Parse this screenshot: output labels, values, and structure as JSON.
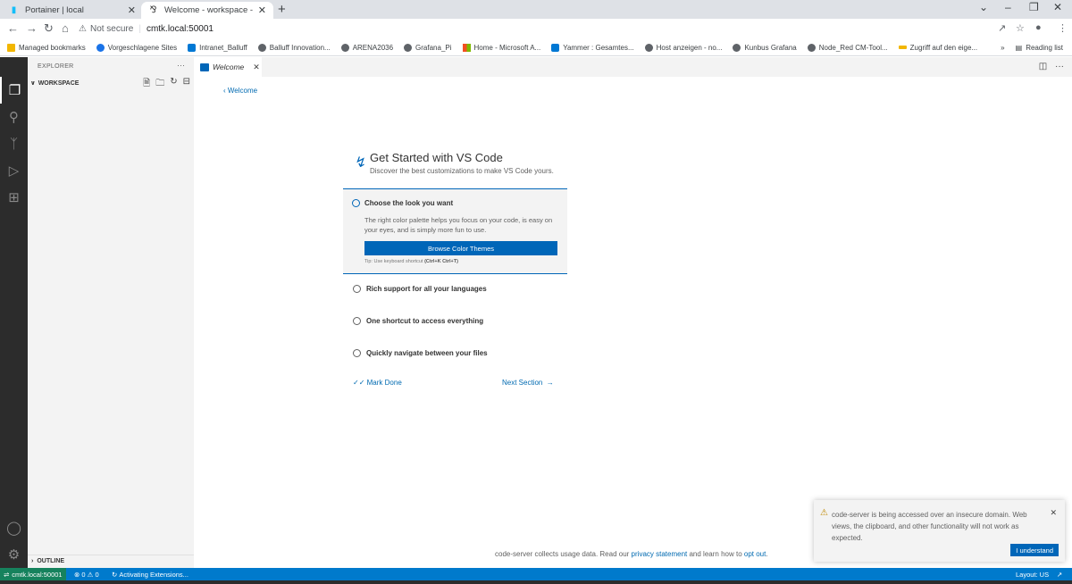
{
  "browser": {
    "tabs": [
      {
        "title": "Portainer | local",
        "icon": "portainer-icon"
      },
      {
        "title": "Welcome - workspace - code-se",
        "icon": "vscode-icon"
      }
    ],
    "address": {
      "security": "Not secure",
      "url": "cmtk.local:50001"
    },
    "bookmarks": [
      {
        "label": "Managed bookmarks",
        "icon": "folder"
      },
      {
        "label": "Vorgeschlagene Sites",
        "icon": "bing"
      },
      {
        "label": "Intranet_Balluff",
        "icon": "sharepoint"
      },
      {
        "label": "Balluff Innovation...",
        "icon": "globe"
      },
      {
        "label": "ARENA2036",
        "icon": "globe"
      },
      {
        "label": "Grafana_Pi",
        "icon": "globe"
      },
      {
        "label": "Home - Microsoft A...",
        "icon": "microsoft"
      },
      {
        "label": "Yammer : Gesamtes...",
        "icon": "yammer"
      },
      {
        "label": "Host anzeigen - no...",
        "icon": "globe"
      },
      {
        "label": "Kunbus Grafana",
        "icon": "globe"
      },
      {
        "label": "Node_Red CM-Tool...",
        "icon": "globe"
      },
      {
        "label": "Zugriff auf den eige...",
        "icon": "link"
      }
    ],
    "bookmarks_more": "»",
    "reading_list": "Reading list"
  },
  "vscode": {
    "sidebar": {
      "header": "EXPLORER",
      "workspace": "WORKSPACE",
      "outline": "OUTLINE"
    },
    "editor_tab": "Welcome",
    "back_link": "Welcome",
    "walkthrough": {
      "title": "Get Started with VS Code",
      "subtitle": "Discover the best customizations to make VS Code yours.",
      "expanded_step": {
        "title": "Choose the look you want",
        "description": "The right color palette helps you focus on your code, is easy on your eyes, and is simply more fun to use.",
        "button": "Browse Color Themes",
        "tip_prefix": "Tip: Use keyboard shortcut",
        "tip_shortcut": "(Ctrl+K Ctrl+T)"
      },
      "steps": [
        "Rich support for all your languages",
        "One shortcut to access everything",
        "Quickly navigate between your files"
      ],
      "mark_done": "Mark Done",
      "next_section": "Next Section"
    },
    "footer": {
      "prefix": "code-server collects usage data. Read our",
      "privacy_link": "privacy statement",
      "middle": "and learn how to",
      "opt_out_link": "opt out",
      "suffix": "."
    },
    "notification": {
      "message": "code-server is being accessed over an insecure domain. Web views, the clipboard, and other functionality will not work as expected.",
      "button": "I understand"
    },
    "statusbar": {
      "remote": "cmtk.local:50001",
      "errors": "0",
      "warnings": "0",
      "activity": "Activating Extensions...",
      "layout": "Layout: US"
    },
    "colors": {
      "accent": "#0066b8",
      "statusbar": "#007acc",
      "remote": "#16825d"
    }
  }
}
